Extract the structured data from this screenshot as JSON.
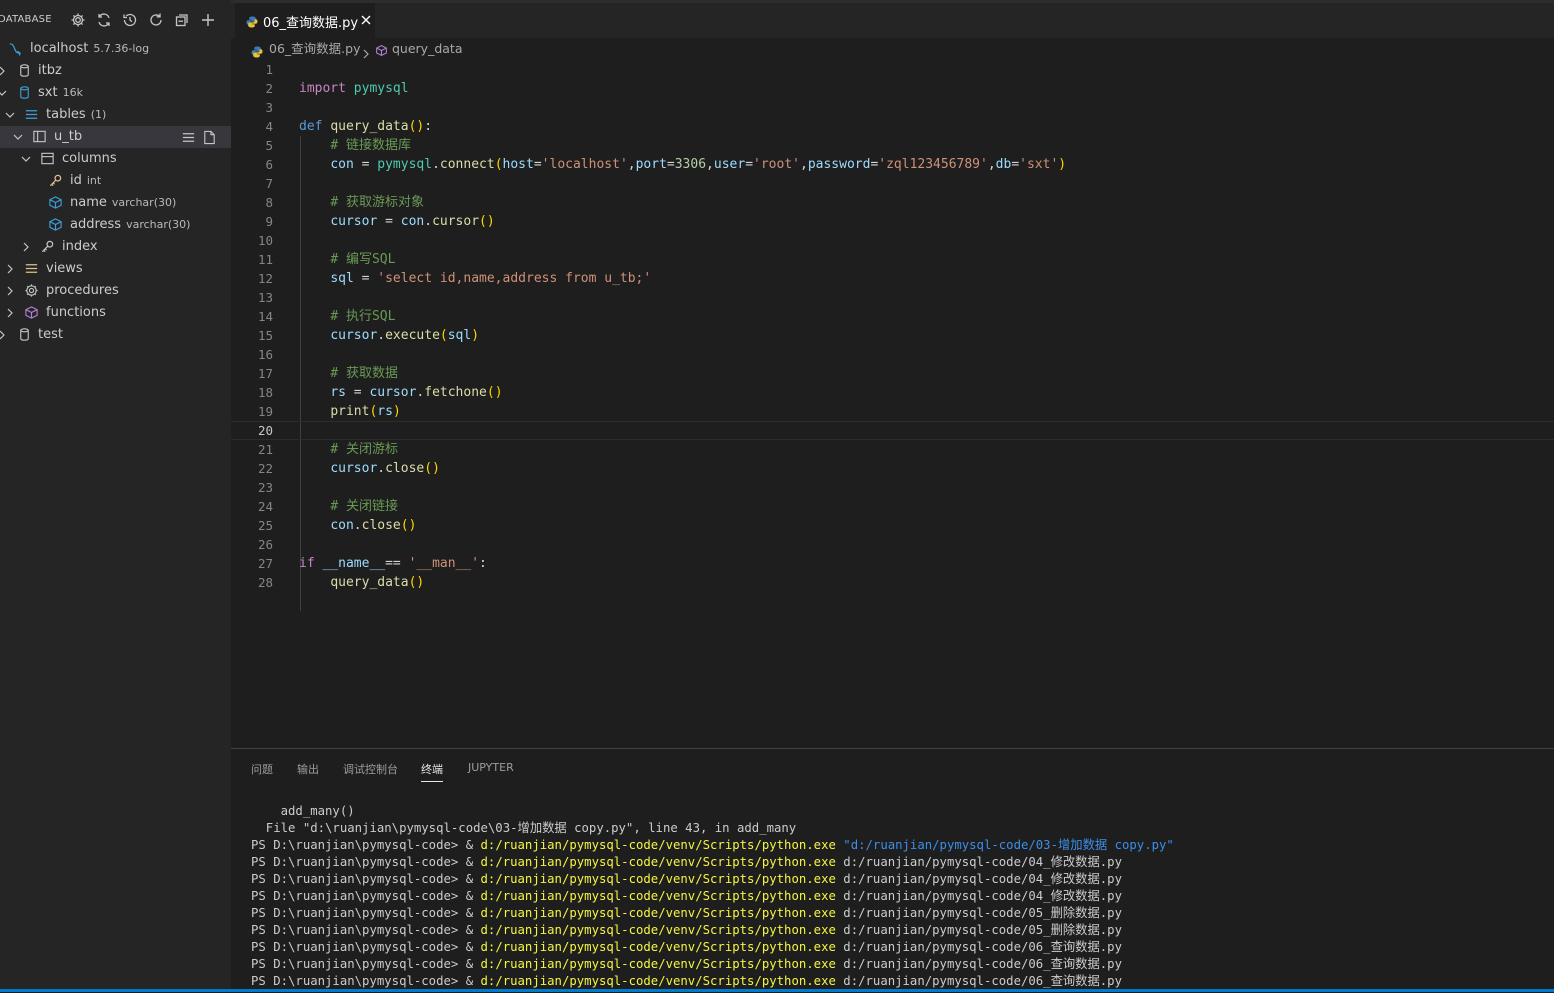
{
  "sidebar": {
    "title": "DATABASE",
    "header_icons": [
      "gear-icon",
      "refresh-icon",
      "history-icon",
      "reload-icon",
      "collapse-all-icon",
      "add-icon"
    ],
    "tree": {
      "connection": {
        "label": "localhost",
        "version": "5.7.36-log"
      },
      "itbz": "itbz",
      "sxt": {
        "label": "sxt",
        "size": "16k"
      },
      "tables": {
        "label": "tables",
        "count": "(1)"
      },
      "u_tb": "u_tb",
      "columns": "columns",
      "col_id": {
        "label": "id",
        "type": "int"
      },
      "col_name": {
        "label": "name",
        "type": "varchar(30)"
      },
      "col_address": {
        "label": "address",
        "type": "varchar(30)"
      },
      "index": "index",
      "views": "views",
      "procedures": "procedures",
      "functions": "functions",
      "test": "test"
    }
  },
  "editor": {
    "tab": {
      "label": "06_查询数据.py"
    },
    "breadcrumb": {
      "file": "06_查询数据.py",
      "symbol": "query_data"
    },
    "current_line": 20,
    "lines": [
      {
        "n": "1"
      },
      {
        "n": "2"
      },
      {
        "n": "3"
      },
      {
        "n": "4"
      },
      {
        "n": "5"
      },
      {
        "n": "6"
      },
      {
        "n": "7"
      },
      {
        "n": "8"
      },
      {
        "n": "9"
      },
      {
        "n": "10"
      },
      {
        "n": "11"
      },
      {
        "n": "12"
      },
      {
        "n": "13"
      },
      {
        "n": "14"
      },
      {
        "n": "15"
      },
      {
        "n": "16"
      },
      {
        "n": "17"
      },
      {
        "n": "18"
      },
      {
        "n": "19"
      },
      {
        "n": "20"
      },
      {
        "n": "21"
      },
      {
        "n": "22"
      },
      {
        "n": "23"
      },
      {
        "n": "24"
      },
      {
        "n": "25"
      },
      {
        "n": "26"
      },
      {
        "n": "27"
      },
      {
        "n": "28"
      }
    ],
    "code": {
      "l2_kw": "import",
      "l2_mod": "pymysql",
      "l4_kw": "def",
      "l4_fn": "query_data",
      "l5": "# 链接数据库",
      "l6_var": "con",
      "l6_mod": "pymysql",
      "l6_fn": "connect",
      "l6_host_k": "host",
      "l6_host_v": "'localhost'",
      "l6_port_k": "port",
      "l6_port_v": "3306",
      "l6_user_k": "user",
      "l6_user_v": "'root'",
      "l6_pw_k": "password",
      "l6_pw_v": "'zql123456789'",
      "l6_db_k": "db",
      "l6_db_v": "'sxt'",
      "l8": "# 获取游标对象",
      "l9_var": "cursor",
      "l9_obj": "con",
      "l9_fn": "cursor",
      "l11": "# 编写SQL",
      "l12_var": "sql",
      "l12_str": "'select id,name,address from u_tb;'",
      "l14": "# 执行SQL",
      "l15_obj": "cursor",
      "l15_fn": "execute",
      "l15_arg": "sql",
      "l17": "# 获取数据",
      "l18_var": "rs",
      "l18_obj": "cursor",
      "l18_fn": "fetchone",
      "l19_fn": "print",
      "l19_arg": "rs",
      "l21": "# 关闭游标",
      "l22_obj": "cursor",
      "l22_fn": "close",
      "l24": "# 关闭链接",
      "l25_obj": "con",
      "l25_fn": "close",
      "l27_kw": "if",
      "l27_var": "__name__",
      "l27_op": "== ",
      "l27_str": "'__man__'",
      "l28_fn": "query_data"
    }
  },
  "panel": {
    "tabs": [
      "问题",
      "输出",
      "调试控制台",
      "终端",
      "JUPYTER"
    ],
    "active_tab": "终端",
    "terminal": {
      "line1": "    add_many()",
      "line2": "  File \"d:\\ruanjian\\pymysql-code\\03-增加数据 copy.py\", line 43, in add_many",
      "prompt": "PS D:\\ruanjian\\pymysql-code> & ",
      "exe": "d:/ruanjian/pymysql-code/venv/Scripts/python.exe",
      "runs": [
        "\"d:/ruanjian/pymysql-code/03-增加数据 copy.py\"",
        "d:/ruanjian/pymysql-code/04_修改数据.py",
        "d:/ruanjian/pymysql-code/04_修改数据.py",
        "d:/ruanjian/pymysql-code/04_修改数据.py",
        "d:/ruanjian/pymysql-code/05_删除数据.py",
        "d:/ruanjian/pymysql-code/05_删除数据.py",
        "d:/ruanjian/pymysql-code/06_查询数据.py",
        "d:/ruanjian/pymysql-code/06_查询数据.py",
        "d:/ruanjian/pymysql-code/06_查询数据.py"
      ]
    }
  },
  "colors": {
    "accent": "#007acc",
    "keyword": "#c586c0",
    "function": "#dcdcaa",
    "string": "#ce9178",
    "comment": "#6a9955"
  }
}
